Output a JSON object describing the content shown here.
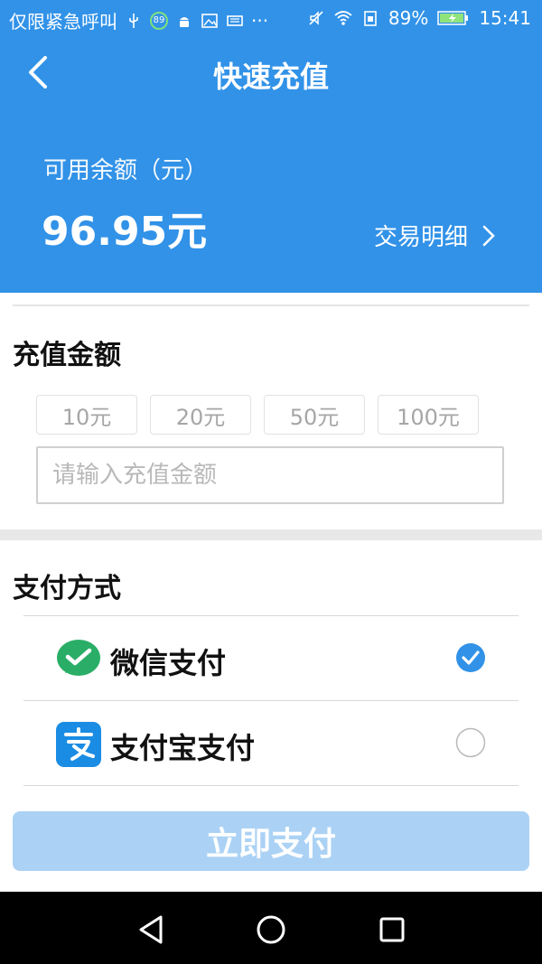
{
  "status_bar": {
    "carrier": "仅限紧急呼叫",
    "badge": "89",
    "dots": "···",
    "battery": "89%",
    "time": "15:41"
  },
  "header": {
    "title": "快速充值",
    "balance_label": "可用余额（元）",
    "balance_value": "96.95元",
    "detail_link": "交易明细"
  },
  "recharge": {
    "title": "充值金额",
    "options": [
      "10元",
      "20元",
      "50元",
      "100元"
    ],
    "input_placeholder": "请输入充值金额",
    "input_value": ""
  },
  "payment": {
    "title": "支付方式",
    "methods": [
      {
        "label": "微信支付",
        "selected": true
      },
      {
        "label": "支付宝支付",
        "selected": false
      }
    ]
  },
  "submit_label": "立即支付",
  "colors": {
    "primary": "#3192e8",
    "submit_disabled": "#abd2f5",
    "wechat": "#2aae67",
    "alipay": "#1b8ce3"
  }
}
